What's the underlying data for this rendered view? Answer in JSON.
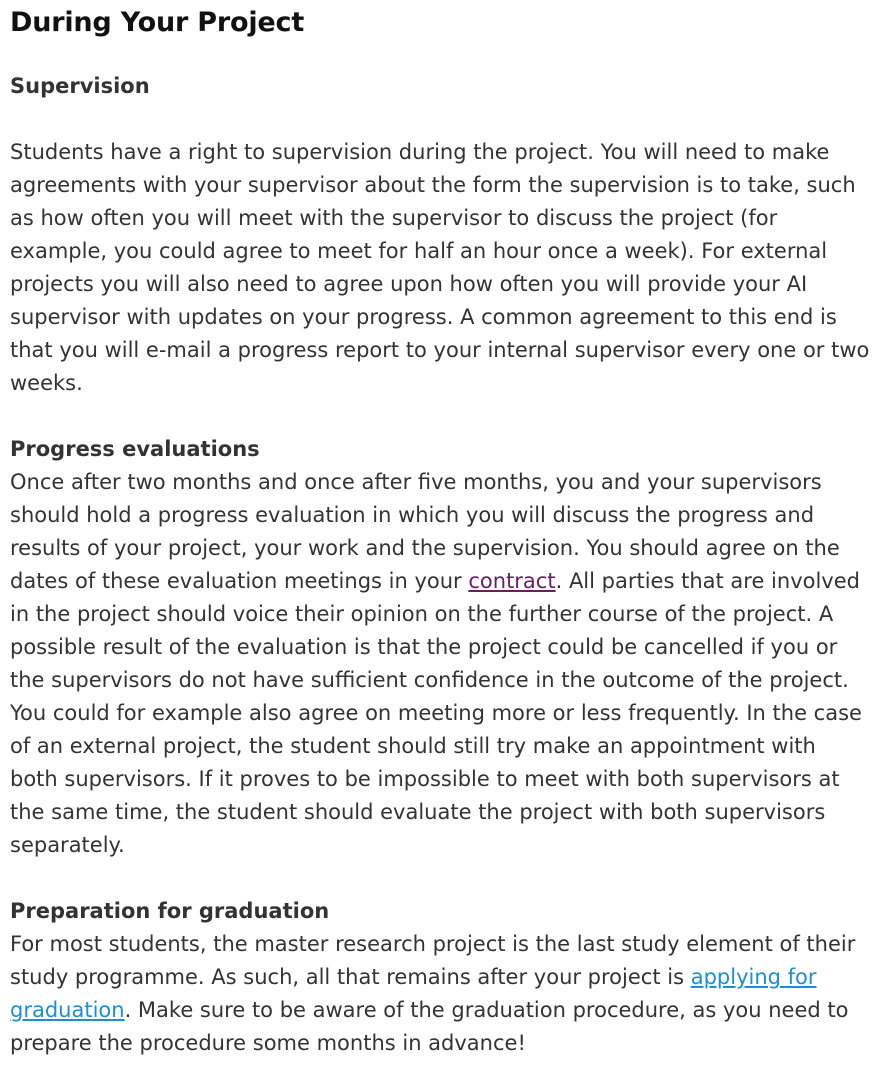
{
  "page": {
    "title": "During Your Project"
  },
  "supervision": {
    "heading": "Supervision",
    "text": "Students have a right to supervision during the project. You will need to make agreements with your supervisor about the form the supervision is to take, such as how often you will meet with the supervisor to discuss the project (for example, you could agree to meet for half an hour once a week). For external projects you will also need to agree upon how often you will provide your AI supervisor with updates on your progress. A common agreement to this end is that you will e-mail a progress report to your internal supervisor every one or two weeks."
  },
  "progress": {
    "heading": "Progress evaluations",
    "text_before": "Once after two months and once after five months, you and your supervisors should hold a progress evaluation in which you will discuss the progress and results of your project, your work and the supervision. You should agree on the dates of these evaluation meetings in your ",
    "link_label": "contract",
    "text_after": ". All parties that are involved in the project should voice their opinion on the further course of the project. A possible result of the evaluation is that the project could be cancelled if you or the supervisors do not have sufficient confidence in the outcome of the project. You could for example also agree on meeting more or less frequently. In the case of an external project, the student should still try make an appointment with both supervisors. If it proves to be impossible to meet with both supervisors at the same time, the student should evaluate the project with both supervisors separately."
  },
  "graduation": {
    "heading": "Preparation for graduation",
    "text_before": "For most students, the master research project is the last study element of their study programme. As such, all that remains after your project is ",
    "link_label": "applying for graduation",
    "text_after": ". Make sure to be aware of the graduation procedure, as you need to prepare the procedure some months in advance!"
  },
  "colors": {
    "visited_link": "#6b1d5c",
    "link": "#1a8fd6"
  }
}
